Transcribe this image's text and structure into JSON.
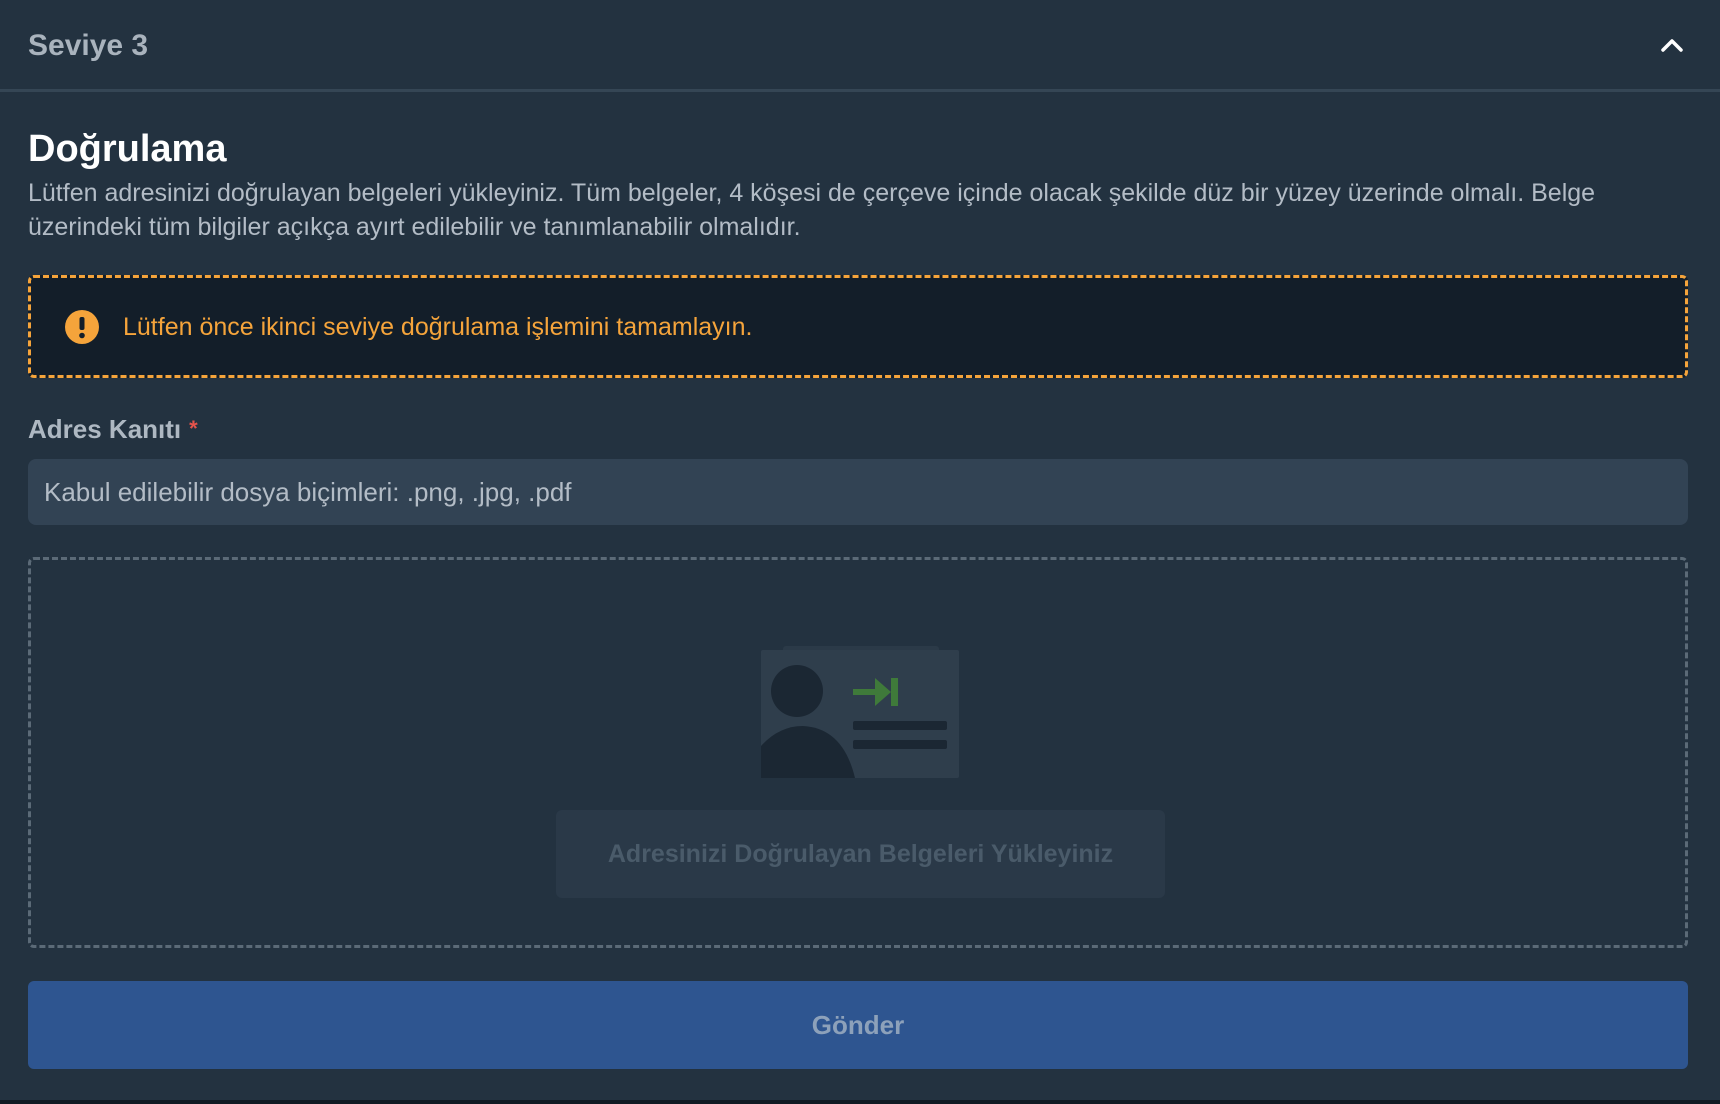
{
  "header": {
    "title": "Seviye 3",
    "toggle_icon": "chevron-up-icon"
  },
  "section": {
    "title": "Doğrulama",
    "description": "Lütfen adresinizi doğrulayan belgeleri yükleyiniz. Tüm belgeler, 4 köşesi de çerçeve içinde olacak şekilde düz bir yüzey üzerinde olmalı. Belge üzerindeki tüm bilgiler açıkça ayırt edilebilir ve tanımlanabilir olmalıdır."
  },
  "warning": {
    "icon": "exclamation-circle-icon",
    "text": "Lütfen önce ikinci seviye doğrulama işlemini tamamlayın.",
    "color": "#f5a43b"
  },
  "address_proof": {
    "label": "Adres Kanıtı",
    "required_mark": "*",
    "accepted_formats": "Kabul edilebilir dosya biçimleri: .png, .jpg, .pdf"
  },
  "dropzone": {
    "illustration": "id-card-icon",
    "upload_label": "Adresinizi Doğrulayan Belgeleri Yükleyiniz"
  },
  "submit": {
    "label": "Gönder",
    "color": "#2e5590"
  }
}
